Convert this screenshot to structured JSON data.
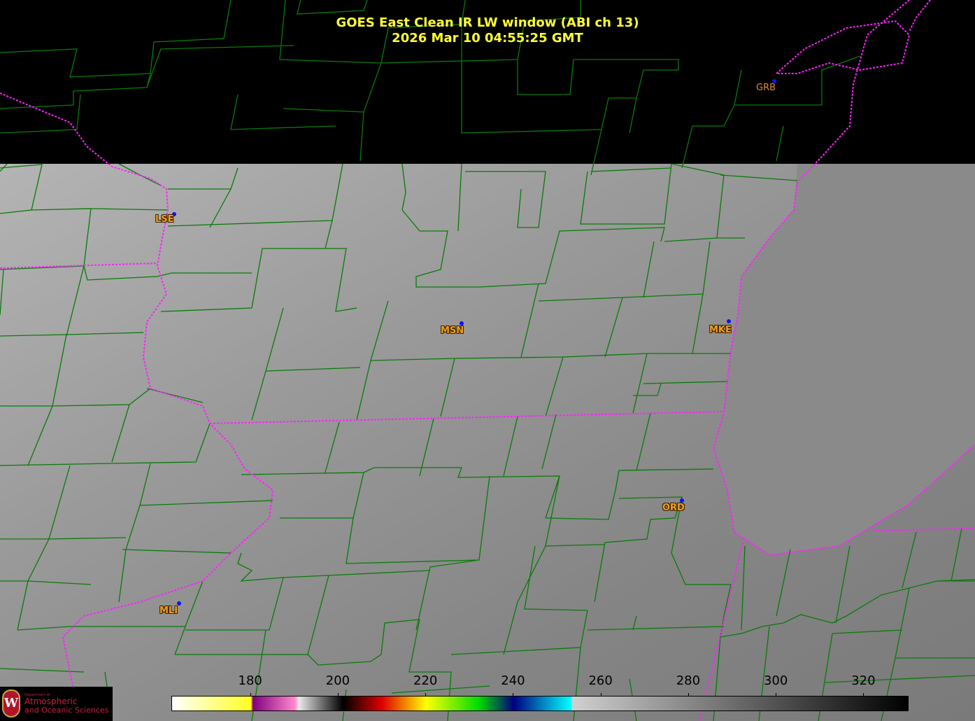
{
  "header": {
    "title": "GOES East Clean IR LW window (ABI ch 13)",
    "timestamp": "2026 Mar 10  04:55:25 GMT"
  },
  "cities": [
    {
      "code": "GRB"
    },
    {
      "code": "LSE"
    },
    {
      "code": "MSN"
    },
    {
      "code": "MKE"
    },
    {
      "code": "ORD"
    },
    {
      "code": "MLI"
    }
  ],
  "colorbar": {
    "unit_ticks": [
      "180",
      "200",
      "220",
      "240",
      "260",
      "280",
      "300",
      "320"
    ],
    "range": [
      162,
      330
    ],
    "stops": [
      {
        "value": 162,
        "color": "#ffffff"
      },
      {
        "value": 180,
        "color": "#ffff20"
      },
      {
        "value": 180.5,
        "color": "#800080"
      },
      {
        "value": 190,
        "color": "#ff88cc"
      },
      {
        "value": 191,
        "color": "#e8e8e8"
      },
      {
        "value": 201,
        "color": "#000000"
      },
      {
        "value": 210,
        "color": "#e00000"
      },
      {
        "value": 220,
        "color": "#ffff00"
      },
      {
        "value": 232,
        "color": "#00dd00"
      },
      {
        "value": 240,
        "color": "#000080"
      },
      {
        "value": 253,
        "color": "#00ffff"
      },
      {
        "value": 253.5,
        "color": "#d0d0d0"
      },
      {
        "value": 330,
        "color": "#000000"
      }
    ]
  },
  "logo": {
    "line0": "Department of",
    "line1": "Atmospheric",
    "line2": "and Oceanic Sciences"
  },
  "colors": {
    "county_lines": "#0a7a0a",
    "state_borders": "#ff22ff",
    "title": "#ffff33",
    "city_label": "#f0a020",
    "city_dot": "#1010ff"
  }
}
